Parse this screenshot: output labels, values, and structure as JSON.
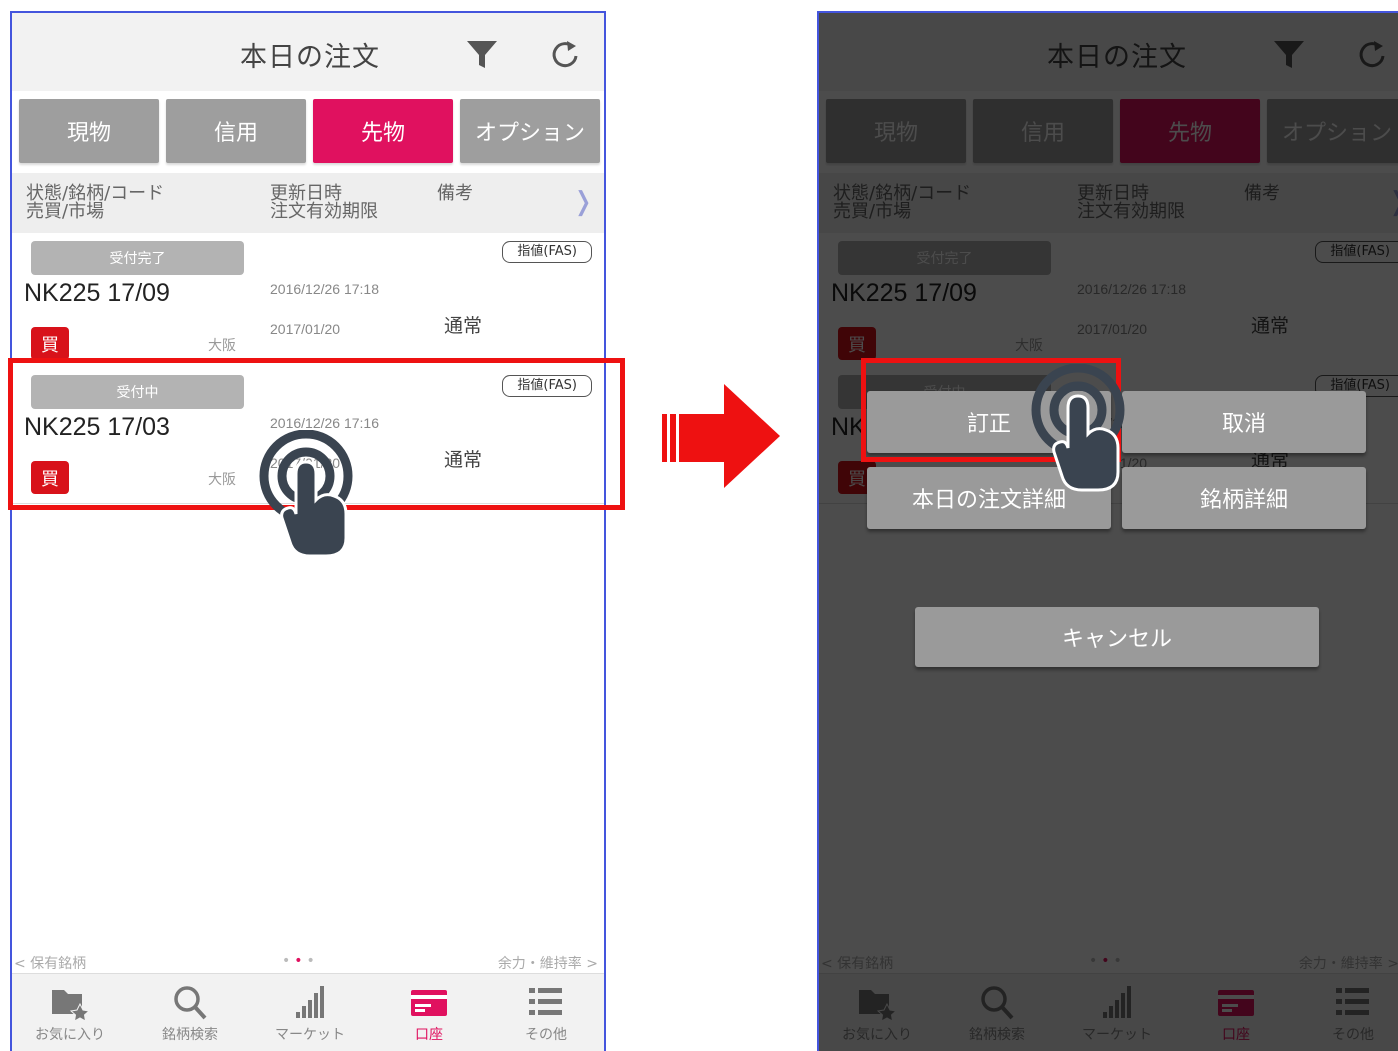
{
  "header": {
    "title": "本日の注文",
    "filter_icon": "filter-icon",
    "refresh_icon": "refresh-icon"
  },
  "tabs": [
    {
      "label": "現物",
      "active": false
    },
    {
      "label": "信用",
      "active": false
    },
    {
      "label": "先物",
      "active": true
    },
    {
      "label": "オプション",
      "active": false
    }
  ],
  "columns": {
    "col1_line1": "状態/銘柄/コード",
    "col1_line2": "売買/市場",
    "col2_line1": "更新日時",
    "col2_line2": "注文有効期限",
    "col3": "備考",
    "more": "❭"
  },
  "orders": [
    {
      "status": "受付完了",
      "order_type": "指値(FAS)",
      "symbol": "NK225 17/09",
      "updated": "2016/12/26 17:18",
      "expiry": "2017/01/20",
      "condition": "通常",
      "side": "買",
      "market": "大阪"
    },
    {
      "status": "受付中",
      "order_type": "指値(FAS)",
      "symbol": "NK225 17/03",
      "updated": "2016/12/26 17:16",
      "expiry": "2017/01/20",
      "condition": "通常",
      "side": "買",
      "market": "大阪"
    }
  ],
  "pager": {
    "left": "< 保有銘柄",
    "right": "余力・維持率 >",
    "dots": "•••"
  },
  "bottom_nav": [
    {
      "label": "お気に入り",
      "icon": "favorite-folder-icon",
      "active": false
    },
    {
      "label": "銘柄検索",
      "icon": "search-icon",
      "active": false
    },
    {
      "label": "マーケット",
      "icon": "bar-chart-icon",
      "active": false
    },
    {
      "label": "口座",
      "icon": "account-card-icon",
      "active": true
    },
    {
      "label": "その他",
      "icon": "list-icon",
      "active": false
    }
  ],
  "action_menu": {
    "correct": "訂正",
    "cancel_order": "取消",
    "order_detail": "本日の注文詳細",
    "symbol_detail": "銘柄詳細",
    "close": "キャンセル"
  },
  "colors": {
    "accent": "#e0115f",
    "buy": "#d8121a",
    "highlight": "#ee1111",
    "frame": "#4455dd"
  }
}
